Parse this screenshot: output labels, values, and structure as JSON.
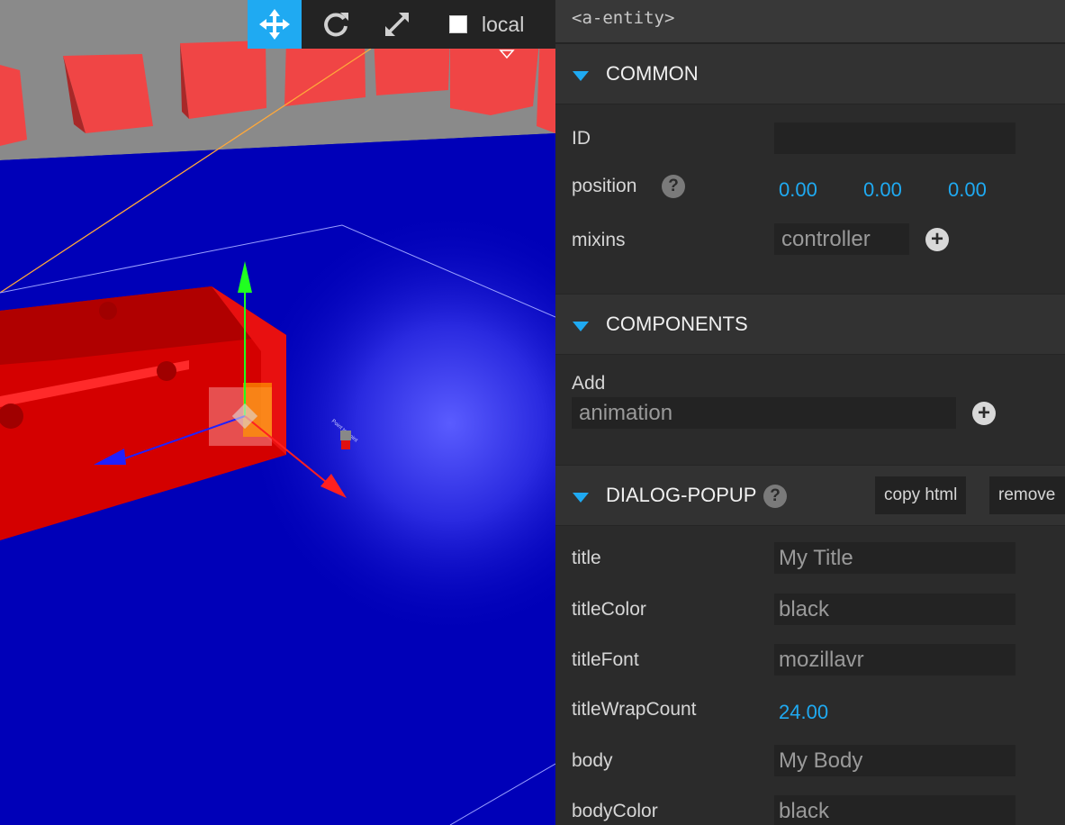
{
  "toolbar": {
    "tools": [
      {
        "name": "translate",
        "icon": "move-arrows-icon",
        "active": true
      },
      {
        "name": "rotate",
        "icon": "rotate-icon",
        "active": false
      },
      {
        "name": "scale",
        "icon": "scale-arrows-icon",
        "active": false
      }
    ],
    "local_label": "local",
    "local_checked": false
  },
  "viewport": {
    "object_label": "Point to Point",
    "colors": {
      "floor": "#0000b8",
      "boxes": "#f04545",
      "gizmo_x": "#ff2020",
      "gizmo_y": "#20ff20",
      "gizmo_z": "#2020ff"
    }
  },
  "inspector": {
    "entity_tag": "<a-entity>",
    "accent": "#1faaf2",
    "common": {
      "title": "COMMON",
      "id_label": "ID",
      "id_value": "",
      "position_label": "position",
      "position": {
        "x": "0.00",
        "y": "0.00",
        "z": "0.00"
      },
      "mixins_label": "mixins",
      "mixins_value": "controller"
    },
    "components": {
      "title": "COMPONENTS",
      "add_label": "Add",
      "add_value": "animation"
    },
    "dialog_popup": {
      "title": "DIALOG-POPUP",
      "copy_html_label": "copy html",
      "remove_label": "remove",
      "props": [
        {
          "label": "title",
          "value": "My Title",
          "kind": "text"
        },
        {
          "label": "titleColor",
          "value": "black",
          "kind": "text"
        },
        {
          "label": "titleFont",
          "value": "mozillavr",
          "kind": "text"
        },
        {
          "label": "titleWrapCount",
          "value": "24.00",
          "kind": "number"
        },
        {
          "label": "body",
          "value": "My Body",
          "kind": "text"
        },
        {
          "label": "bodyColor",
          "value": "black",
          "kind": "text"
        }
      ]
    }
  }
}
